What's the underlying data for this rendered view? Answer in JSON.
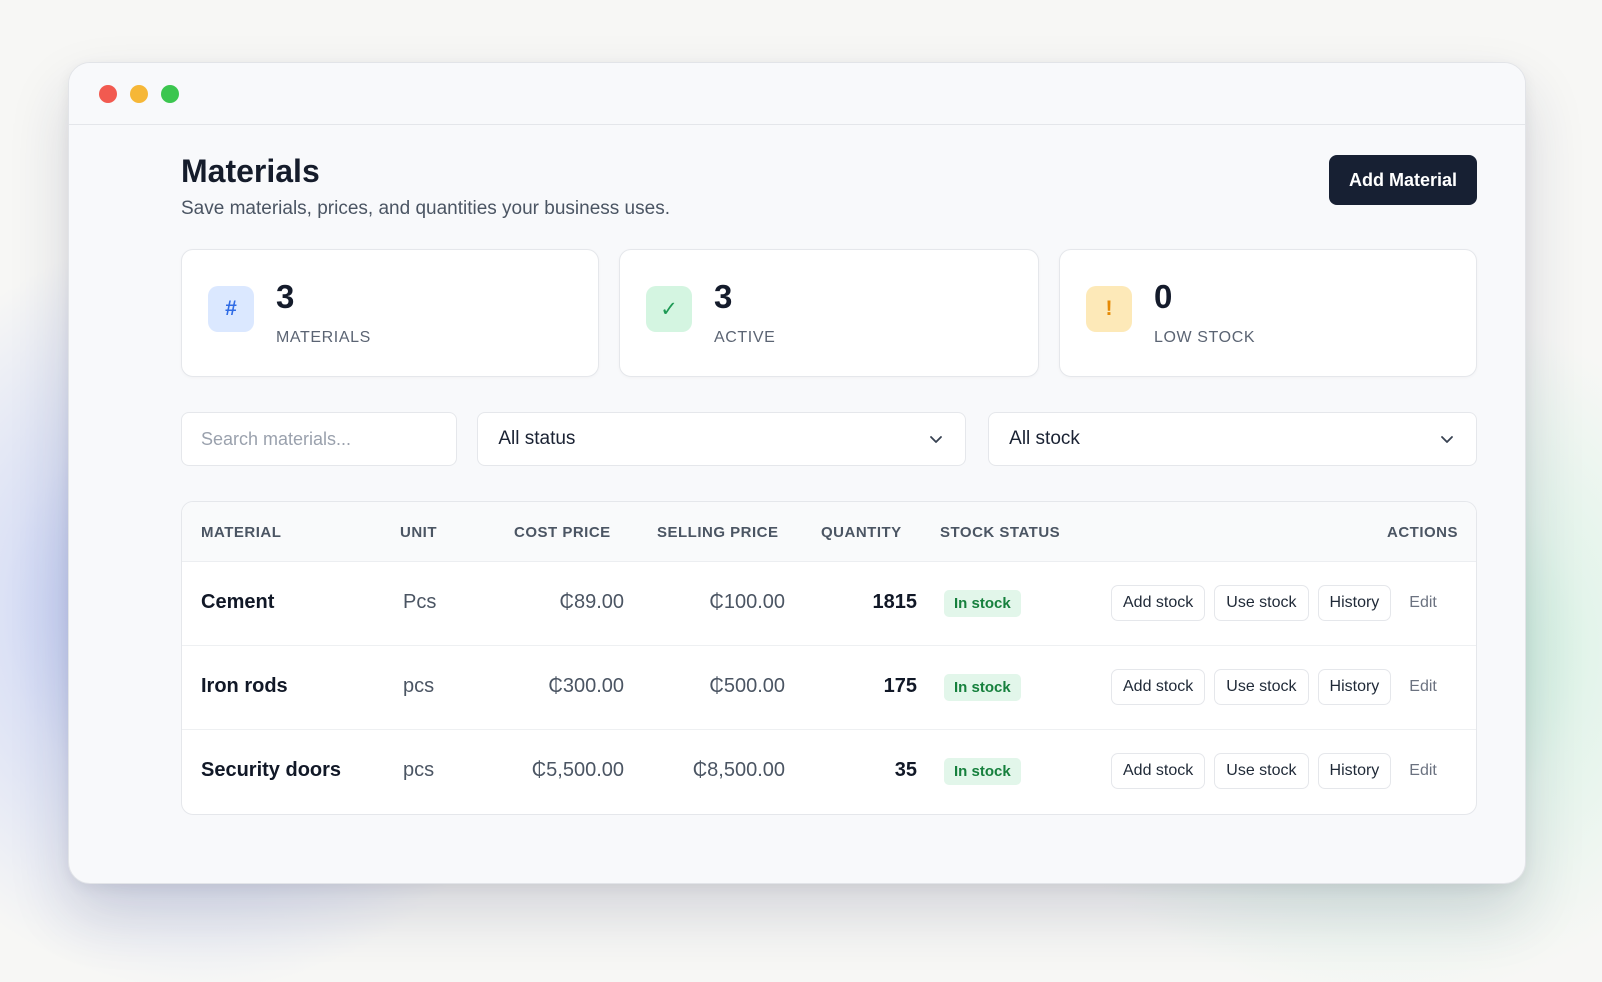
{
  "page": {
    "title": "Materials",
    "subtitle": "Save materials, prices, and quantities your business uses.",
    "add_button": "Add Material"
  },
  "stats": [
    {
      "icon": "hash-icon",
      "glyph": "#",
      "value": "3",
      "label": "MATERIALS",
      "color": "#2f6be5"
    },
    {
      "icon": "check-icon",
      "glyph": "✓",
      "value": "3",
      "label": "ACTIVE",
      "color": "#1e9a55"
    },
    {
      "icon": "warning-icon",
      "glyph": "!",
      "value": "0",
      "label": "LOW STOCK",
      "color": "#e58a06"
    }
  ],
  "filters": {
    "search_placeholder": "Search materials...",
    "status_select": "All status",
    "stock_select": "All stock"
  },
  "table": {
    "headers": {
      "material": "MATERIAL",
      "unit": "UNIT",
      "cost": "COST PRICE",
      "selling": "SELLING PRICE",
      "quantity": "QUANTITY",
      "status": "STOCK STATUS",
      "actions": "ACTIONS"
    },
    "rows": [
      {
        "name": "Cement",
        "unit": "Pcs",
        "cost": "₵89.00",
        "selling": "₵100.00",
        "quantity": "1815",
        "status": "In stock"
      },
      {
        "name": "Iron rods",
        "unit": "pcs",
        "cost": "₵300.00",
        "selling": "₵500.00",
        "quantity": "175",
        "status": "In stock"
      },
      {
        "name": "Security doors",
        "unit": "pcs",
        "cost": "₵5,500.00",
        "selling": "₵8,500.00",
        "quantity": "35",
        "status": "In stock"
      }
    ],
    "action_labels": {
      "add_stock": "Add stock",
      "use_stock": "Use stock",
      "history": "History",
      "edit": "Edit"
    }
  },
  "colors": {
    "primary_button": "#172033",
    "in_stock_bg": "#e2f6ea",
    "in_stock_text": "#16803d"
  }
}
